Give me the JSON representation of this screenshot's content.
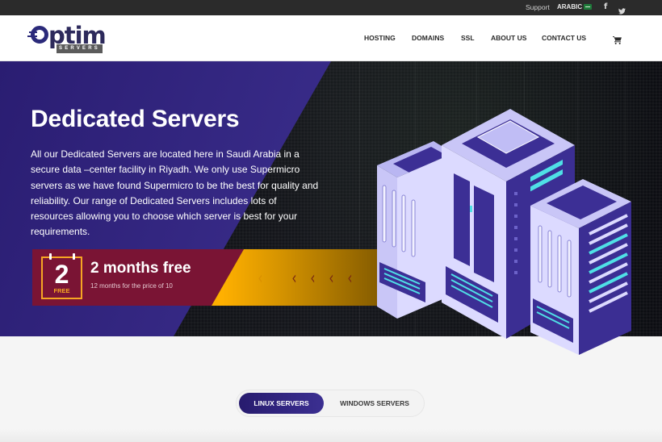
{
  "topbar": {
    "support": "Support",
    "language": "ARABIC",
    "social": [
      "facebook-icon",
      "twitter-icon"
    ]
  },
  "header": {
    "logo": {
      "word": "ptim",
      "tagline": "SERVERS"
    },
    "nav": [
      "HOSTING",
      "DOMAINS",
      "SSL",
      "ABOUT US",
      "CONTACT US"
    ],
    "cart_icon": "cart-icon"
  },
  "hero": {
    "title": "Dedicated Servers",
    "description": "All our Dedicated Servers are located here in Saudi Arabia in a secure data –center facility in Riyadh. We only use Supermicro servers as we have found Supermicro to be the best for quality and reliability. Our range of Dedicated Servers includes lots of resources allowing you to choose which server is best for your requirements."
  },
  "promo": {
    "calendar_number": "2",
    "calendar_label": "FREE",
    "title": "2 months free",
    "subtitle": "12 months for the price of 10",
    "chevron": "‹"
  },
  "tabs": {
    "items": [
      "LINUX SERVERS",
      "WINDOWS SERVERS"
    ],
    "active": "LINUX SERVERS"
  },
  "colors": {
    "brand_purple": "#2d2a7a",
    "promo_maroon": "#7a1434",
    "promo_gold": "#ffb300",
    "accent_orange": "#f6a623",
    "cyan": "#4fe0e6"
  }
}
